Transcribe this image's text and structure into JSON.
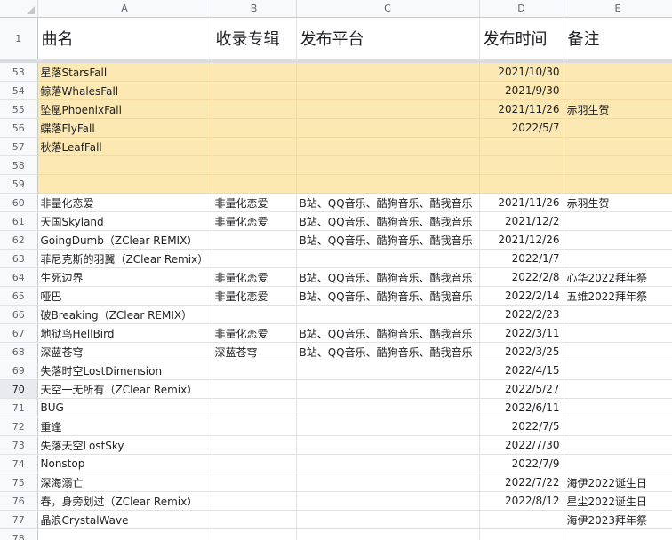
{
  "columns": [
    "A",
    "B",
    "C",
    "D",
    "E"
  ],
  "header": {
    "row_number": "1",
    "a": "曲名",
    "b": "收录专辑",
    "c": "发布平台",
    "d": "发布时间",
    "e": "备注"
  },
  "rows": [
    {
      "n": "53",
      "a": "星落StarsFall",
      "b": "",
      "c": "",
      "d": "2021/10/30",
      "e": ""
    },
    {
      "n": "54",
      "a": "鲸落WhalesFall",
      "b": "",
      "c": "",
      "d": "2021/9/30",
      "e": ""
    },
    {
      "n": "55",
      "a": "坠凰PhoenixFall",
      "b": "",
      "c": "",
      "d": "2021/11/26",
      "e": "赤羽生贺"
    },
    {
      "n": "56",
      "a": "蝶落FlyFall",
      "b": "",
      "c": "",
      "d": "2022/5/7",
      "e": ""
    },
    {
      "n": "57",
      "a": "秋落LeafFall",
      "b": "",
      "c": "",
      "d": "",
      "e": ""
    },
    {
      "n": "58",
      "a": "",
      "b": "",
      "c": "",
      "d": "",
      "e": ""
    },
    {
      "n": "59",
      "a": "",
      "b": "",
      "c": "",
      "d": "",
      "e": ""
    },
    {
      "n": "60",
      "a": "非量化恋爱",
      "b": "非量化恋爱",
      "c": "B站、QQ音乐、酷狗音乐、酷我音乐",
      "d": "2021/11/26",
      "e": "赤羽生贺"
    },
    {
      "n": "61",
      "a": "天国Skyland",
      "b": "非量化恋爱",
      "c": "B站、QQ音乐、酷狗音乐、酷我音乐",
      "d": "2021/12/2",
      "e": ""
    },
    {
      "n": "62",
      "a": "GoingDumb（ZClear REMIX）",
      "b": "",
      "c": "B站、QQ音乐、酷狗音乐、酷我音乐",
      "d": "2021/12/26",
      "e": ""
    },
    {
      "n": "63",
      "a": "菲尼克斯的羽翼（ZClear Remix）",
      "b": "",
      "c": "",
      "d": "2022/1/7",
      "e": ""
    },
    {
      "n": "64",
      "a": "生死边界",
      "b": "非量化恋爱",
      "c": "B站、QQ音乐、酷狗音乐、酷我音乐",
      "d": "2022/2/8",
      "e": "心华2022拜年祭"
    },
    {
      "n": "65",
      "a": "哑巴",
      "b": "非量化恋爱",
      "c": "B站、QQ音乐、酷狗音乐、酷我音乐",
      "d": "2022/2/14",
      "e": "五维2022拜年祭"
    },
    {
      "n": "66",
      "a": "破Breaking（ZClear REMIX）",
      "b": "",
      "c": "",
      "d": "2022/2/23",
      "e": ""
    },
    {
      "n": "67",
      "a": "地狱鸟HellBird",
      "b": "非量化恋爱",
      "c": "B站、QQ音乐、酷狗音乐、酷我音乐",
      "d": "2022/3/11",
      "e": ""
    },
    {
      "n": "68",
      "a": "深蓝苍穹",
      "b": "深蓝苍穹",
      "c": "B站、QQ音乐、酷狗音乐、酷我音乐",
      "d": "2022/3/25",
      "e": ""
    },
    {
      "n": "69",
      "a": "失落时空LostDimension",
      "b": "",
      "c": "",
      "d": "2022/4/15",
      "e": ""
    },
    {
      "n": "70",
      "a": "天空一无所有（ZClear Remix）",
      "b": "",
      "c": "",
      "d": "2022/5/27",
      "e": ""
    },
    {
      "n": "71",
      "a": "BUG",
      "b": "",
      "c": "",
      "d": "2022/6/11",
      "e": ""
    },
    {
      "n": "72",
      "a": "重逢",
      "b": "",
      "c": "",
      "d": "2022/7/5",
      "e": ""
    },
    {
      "n": "73",
      "a": "失落天空LostSky",
      "b": "",
      "c": "",
      "d": "2022/7/30",
      "e": ""
    },
    {
      "n": "74",
      "a": "Nonstop",
      "b": "",
      "c": "",
      "d": "2022/7/9",
      "e": ""
    },
    {
      "n": "75",
      "a": "深海溺亡",
      "b": "",
      "c": "",
      "d": "2022/7/22",
      "e": "海伊2022诞生日"
    },
    {
      "n": "76",
      "a": "春，身旁划过（ZClear Remix）",
      "b": "",
      "c": "",
      "d": "2022/8/12",
      "e": "星尘2022诞生日"
    },
    {
      "n": "77",
      "a": "晶浪CrystalWave",
      "b": "",
      "c": "",
      "d": "",
      "e": "海伊2023拜年祭"
    },
    {
      "n": "78",
      "a": "",
      "b": "",
      "c": "",
      "d": "",
      "e": ""
    }
  ],
  "highlight": {
    "rows": [
      "53",
      "54",
      "55",
      "56",
      "57",
      "58",
      "59"
    ],
    "color": "#fce8b2"
  },
  "active_row": "70"
}
